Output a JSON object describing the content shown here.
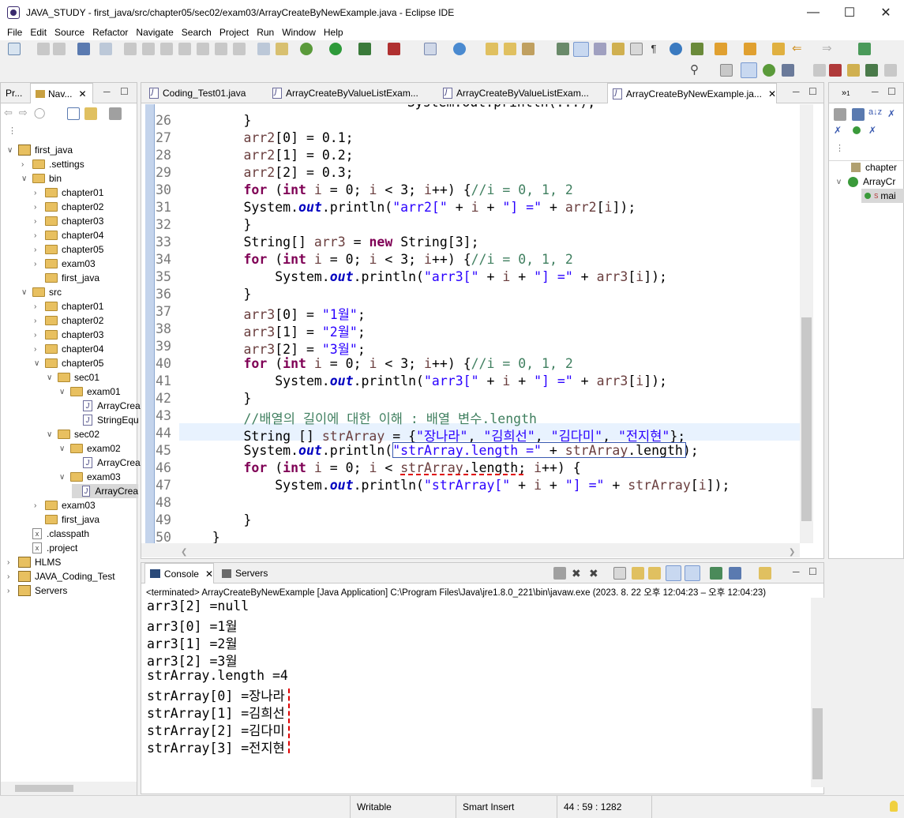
{
  "window": {
    "title": "JAVA_STUDY - first_java/src/chapter05/sec02/exam03/ArrayCreateByNewExample.java - Eclipse IDE"
  },
  "menu": [
    "File",
    "Edit",
    "Source",
    "Refactor",
    "Navigate",
    "Search",
    "Project",
    "Run",
    "Window",
    "Help"
  ],
  "left_panel": {
    "tabs": [
      "Pr...",
      "Nav..."
    ],
    "tree": [
      {
        "label": "first_java",
        "kind": "project",
        "chev": "v"
      },
      {
        "label": ".settings",
        "kind": "folder",
        "chev": ">"
      },
      {
        "label": "bin",
        "kind": "folder",
        "chev": "v"
      },
      {
        "label": "chapter01",
        "kind": "folder",
        "chev": ">"
      },
      {
        "label": "chapter02",
        "kind": "folder",
        "chev": ">"
      },
      {
        "label": "chapter03",
        "kind": "folder",
        "chev": ">"
      },
      {
        "label": "chapter04",
        "kind": "folder",
        "chev": ">"
      },
      {
        "label": "chapter05",
        "kind": "folder",
        "chev": ">"
      },
      {
        "label": "exam03",
        "kind": "folder",
        "chev": ">"
      },
      {
        "label": "first_java",
        "kind": "folder",
        "chev": ""
      },
      {
        "label": "src",
        "kind": "folder",
        "chev": "v"
      },
      {
        "label": "chapter01",
        "kind": "folder",
        "chev": ">"
      },
      {
        "label": "chapter02",
        "kind": "folder",
        "chev": ">"
      },
      {
        "label": "chapter03",
        "kind": "folder",
        "chev": ">"
      },
      {
        "label": "chapter04",
        "kind": "folder",
        "chev": ">"
      },
      {
        "label": "chapter05",
        "kind": "folder",
        "chev": "v"
      },
      {
        "label": "sec01",
        "kind": "folder",
        "chev": "v"
      },
      {
        "label": "exam01",
        "kind": "folder",
        "chev": "v"
      },
      {
        "label": "ArrayCrea",
        "kind": "java",
        "chev": ""
      },
      {
        "label": "StringEqu",
        "kind": "java",
        "chev": ""
      },
      {
        "label": "sec02",
        "kind": "folder",
        "chev": "v"
      },
      {
        "label": "exam02",
        "kind": "folder",
        "chev": "v"
      },
      {
        "label": "ArrayCrea",
        "kind": "java",
        "chev": ""
      },
      {
        "label": "exam03",
        "kind": "folder",
        "chev": "v"
      },
      {
        "label": "ArrayCrea",
        "kind": "java",
        "chev": "",
        "selected": true
      },
      {
        "label": "exam03",
        "kind": "folder",
        "chev": ">"
      },
      {
        "label": "first_java",
        "kind": "folder",
        "chev": ""
      },
      {
        "label": ".classpath",
        "kind": "xml",
        "chev": ""
      },
      {
        "label": ".project",
        "kind": "xml",
        "chev": ""
      },
      {
        "label": "HLMS",
        "kind": "project",
        "chev": ">"
      },
      {
        "label": "JAVA_Coding_Test",
        "kind": "project",
        "chev": ">"
      },
      {
        "label": "Servers",
        "kind": "project",
        "chev": ">"
      }
    ]
  },
  "editor": {
    "tabs": [
      "Coding_Test01.java",
      "ArrayCreateByValueListExam...",
      "ArrayCreateByValueListExam...",
      "ArrayCreateByNewExample.ja..."
    ],
    "lines": [
      {
        "n": "26",
        "t": "        }"
      },
      {
        "n": "27",
        "t": "        arr2[0] = 0.1;"
      },
      {
        "n": "28",
        "t": "        arr2[1] = 0.2;"
      },
      {
        "n": "29",
        "t": "        arr2[2] = 0.3;"
      },
      {
        "n": "30",
        "t": "        for (int i = 0; i < 3; i++) {//i = 0, 1, 2"
      },
      {
        "n": "31",
        "t": "        System.out.println(\"arr2[\" + i + \"] =\" + arr2[i]);"
      },
      {
        "n": "32",
        "t": "        }"
      },
      {
        "n": "33",
        "t": "        String[] arr3 = new String[3];"
      },
      {
        "n": "34",
        "t": "        for (int i = 0; i < 3; i++) {//i = 0, 1, 2"
      },
      {
        "n": "35",
        "t": "            System.out.println(\"arr3[\" + i + \"] =\" + arr3[i]);"
      },
      {
        "n": "36",
        "t": "        }"
      },
      {
        "n": "37",
        "t": "        arr3[0] = \"1월\";"
      },
      {
        "n": "38",
        "t": "        arr3[1] = \"2월\";"
      },
      {
        "n": "39",
        "t": "        arr3[2] = \"3월\";"
      },
      {
        "n": "40",
        "t": "        for (int i = 0; i < 3; i++) {//i = 0, 1, 2"
      },
      {
        "n": "41",
        "t": "            System.out.println(\"arr3[\" + i + \"] =\" + arr3[i]);"
      },
      {
        "n": "42",
        "t": "        }"
      },
      {
        "n": "43",
        "t": "        //배열의 길이에 대한 이해 : 배열 변수.length"
      },
      {
        "n": "44",
        "t": "        String [] strArray = {\"장나라\", \"김희선\", \"김다미\", \"전지현\"};"
      },
      {
        "n": "45",
        "t": "        System.out.println(\"strArray.length =\" + strArray.length);"
      },
      {
        "n": "46",
        "t": "        for (int i = 0; i < strArray.length; i++) {"
      },
      {
        "n": "47",
        "t": "            System.out.println(\"strArray[\" + i + \"] =\" + strArray[i]);"
      },
      {
        "n": "48",
        "t": ""
      },
      {
        "n": "49",
        "t": "        }"
      },
      {
        "n": "50",
        "t": "    }"
      }
    ]
  },
  "right_panel": {
    "tree": [
      {
        "label": "chapter"
      },
      {
        "label": "ArrayCr"
      },
      {
        "label": "mai"
      }
    ]
  },
  "console": {
    "tabs": [
      "Console",
      "Servers"
    ],
    "status": "<terminated> ArrayCreateByNewExample [Java Application] C:\\Program Files\\Java\\jre1.8.0_221\\bin\\javaw.exe  (2023. 8. 22 오후 12:04:23 – 오후 12:04:23)",
    "lines": [
      "arr3[2] =null",
      "arr3[0] =1월",
      "arr3[1] =2월",
      "arr3[2] =3월",
      "strArray.length =4",
      "strArray[0] =장나라",
      "strArray[1] =김희선",
      "strArray[2] =김다미",
      "strArray[3] =전지현"
    ]
  },
  "statusbar": {
    "writable": "Writable",
    "insert": "Smart Insert",
    "position": "44 : 59 : 1282"
  },
  "colors": {
    "keyword": "#7f0055",
    "string": "#2a00ff",
    "comment": "#3f7f5f",
    "field": "#0000c0",
    "annotation_red": "#e00000"
  }
}
